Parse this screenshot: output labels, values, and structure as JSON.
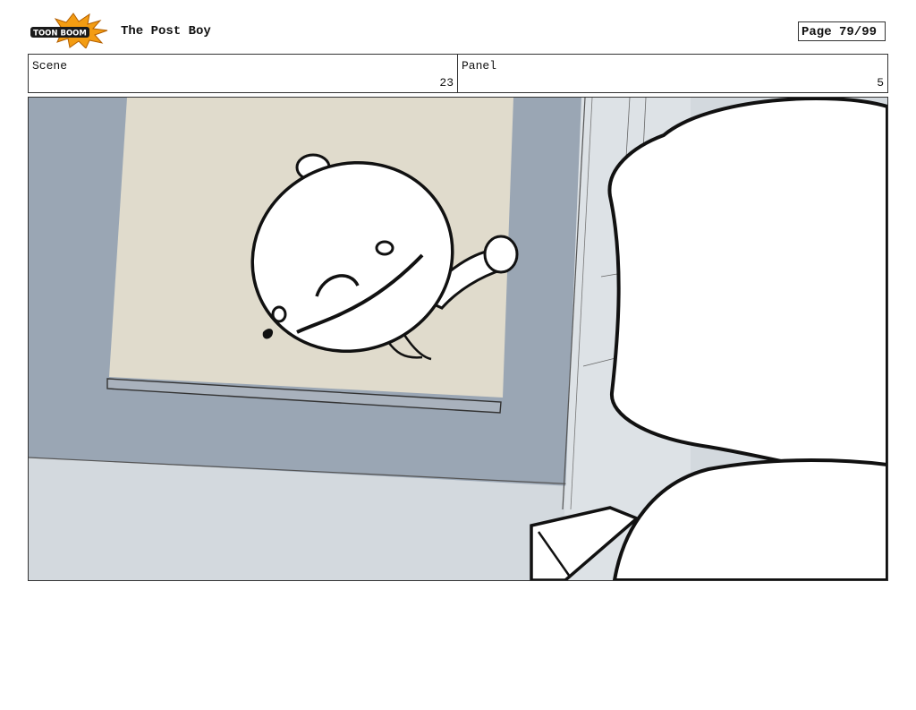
{
  "header": {
    "logo": {
      "icon": "toon-boom-logo",
      "text": "TOON BOOM",
      "colors": {
        "burst": "#f39c12",
        "badge": "#1a1a1a",
        "text": "#ffffff"
      }
    },
    "title": "The Post Boy",
    "page_label": "Page 79/99"
  },
  "info": {
    "scene_label": "Scene",
    "scene_value": "23",
    "panel_label": "Panel",
    "panel_value": "5"
  },
  "panel_art": {
    "icon": "storyboard-sketch",
    "colors": {
      "wall": "#9aa6b4",
      "floor": "#d3d9de",
      "poster": "#e0dbcc",
      "ink": "#111111"
    }
  }
}
